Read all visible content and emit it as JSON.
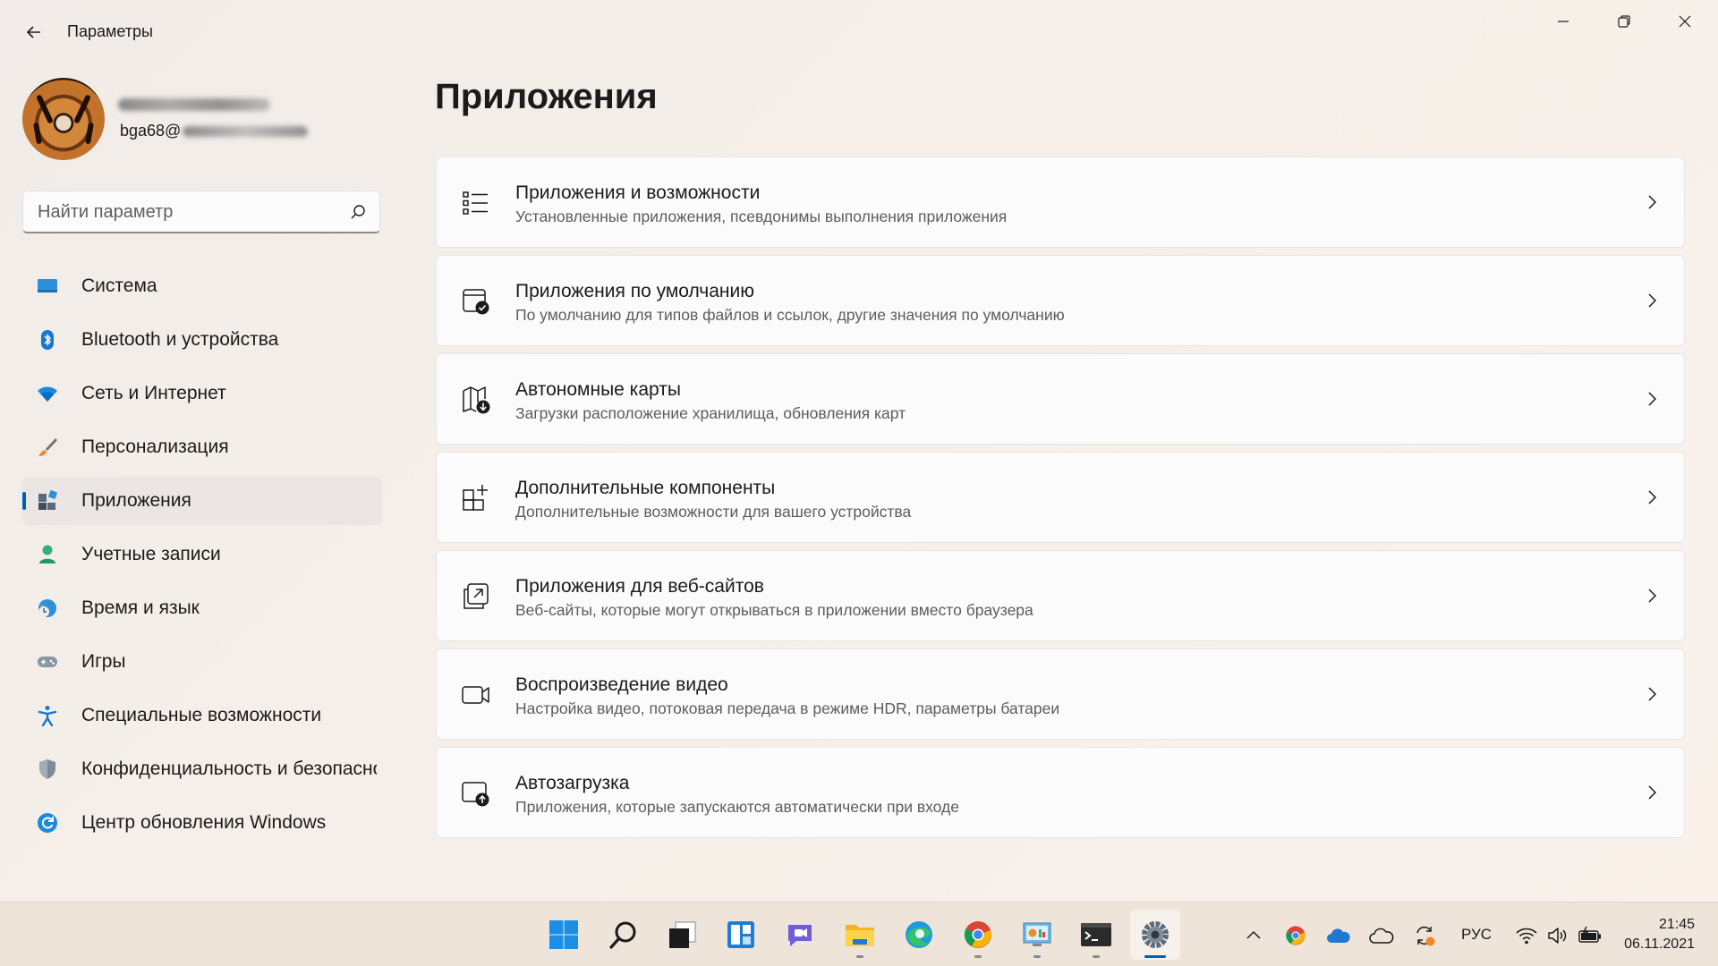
{
  "window": {
    "title": "Параметры",
    "controls": {
      "minimize": "minimize-icon",
      "maximize": "restore-icon",
      "close": "close-icon"
    }
  },
  "profile": {
    "email_prefix": "bga68@"
  },
  "search": {
    "placeholder": "Найти параметр"
  },
  "sidebar": {
    "items": [
      {
        "label": "Система",
        "icon": "system-icon"
      },
      {
        "label": "Bluetooth и устройства",
        "icon": "bluetooth-icon"
      },
      {
        "label": "Сеть и Интернет",
        "icon": "wifi-icon"
      },
      {
        "label": "Персонализация",
        "icon": "brush-icon"
      },
      {
        "label": "Приложения",
        "icon": "apps-icon",
        "active": true
      },
      {
        "label": "Учетные записи",
        "icon": "account-icon"
      },
      {
        "label": "Время и язык",
        "icon": "time-language-icon"
      },
      {
        "label": "Игры",
        "icon": "gamepad-icon"
      },
      {
        "label": "Специальные возможности",
        "icon": "accessibility-icon"
      },
      {
        "label": "Конфиденциальность и безопасность",
        "icon": "shield-icon"
      },
      {
        "label": "Центр обновления Windows",
        "icon": "update-icon"
      }
    ]
  },
  "main": {
    "title": "Приложения",
    "cards": [
      {
        "title": "Приложения и возможности",
        "desc": "Установленные приложения, псевдонимы выполнения приложения",
        "icon": "apps-list-icon"
      },
      {
        "title": "Приложения по умолчанию",
        "desc": "По умолчанию для типов файлов и ссылок, другие значения по умолчанию",
        "icon": "default-apps-icon"
      },
      {
        "title": "Автономные карты",
        "desc": "Загрузки расположение хранилища, обновления карт",
        "icon": "offline-maps-icon"
      },
      {
        "title": "Дополнительные компоненты",
        "desc": "Дополнительные возможности для вашего устройства",
        "icon": "optional-features-icon"
      },
      {
        "title": "Приложения для веб-сайтов",
        "desc": "Веб-сайты, которые могут открываться в приложении вместо браузера",
        "icon": "apps-for-websites-icon"
      },
      {
        "title": "Воспроизведение видео",
        "desc": "Настройка видео, потоковая передача в режиме HDR, параметры батареи",
        "icon": "video-playback-icon"
      },
      {
        "title": "Автозагрузка",
        "desc": "Приложения, которые запускаются автоматически при входе",
        "icon": "startup-icon"
      }
    ]
  },
  "taskbar": {
    "apps": [
      "start-icon",
      "search-icon",
      "task-view-icon",
      "widgets-icon",
      "chat-icon",
      "file-explorer-icon",
      "edge-icon",
      "chrome-icon",
      "control-panel-icon",
      "terminal-icon",
      "settings-icon"
    ],
    "tray": {
      "language": "РУС",
      "time": "21:45",
      "date": "06.11.2021"
    }
  },
  "colors": {
    "accent": "#005fb8",
    "background": "#f3ece7",
    "card": "#fbfbfb"
  }
}
